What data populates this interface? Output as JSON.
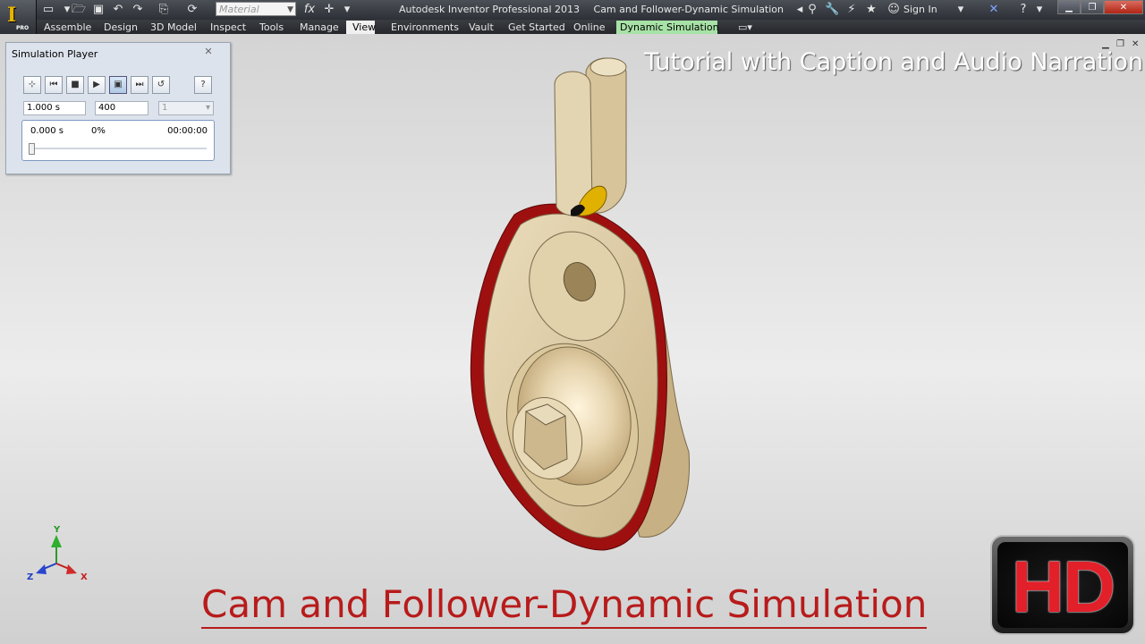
{
  "app": {
    "logo_letter": "I",
    "logo_badge": "PRO",
    "material_placeholder": "Material",
    "title": "Autodesk Inventor Professional 2013",
    "document": "Cam and Follower-Dynamic Simulation",
    "sign_in": "Sign In"
  },
  "ribbon_tabs": [
    {
      "label": "Assemble"
    },
    {
      "label": "Design"
    },
    {
      "label": "3D Model"
    },
    {
      "label": "Inspect"
    },
    {
      "label": "Tools"
    },
    {
      "label": "Manage"
    },
    {
      "label": "View"
    },
    {
      "label": "Environments"
    },
    {
      "label": "Vault"
    },
    {
      "label": "Get Started"
    },
    {
      "label": "Online"
    },
    {
      "label": "Dynamic Simulation"
    }
  ],
  "simulation_player": {
    "title": "Simulation Player",
    "final_time": "1.000 s",
    "images": "400",
    "filter": "1",
    "current_time": "0.000 s",
    "percent": "0%",
    "elapsed": "00:00:00",
    "progress": 0
  },
  "captions": {
    "top": "Tutorial with Caption and Audio Narration",
    "bottom": "Cam and Follower-Dynamic Simulation",
    "badge": "HD"
  },
  "triad": {
    "x": "X",
    "y": "Y",
    "z": "Z"
  },
  "colors": {
    "accent_red": "#b81b1b",
    "active_env_tab": "#a7e2a6",
    "part_tan": "#e3d4b1",
    "cam_outline_red": "#a01010",
    "follower_yellow": "#e0b100"
  }
}
